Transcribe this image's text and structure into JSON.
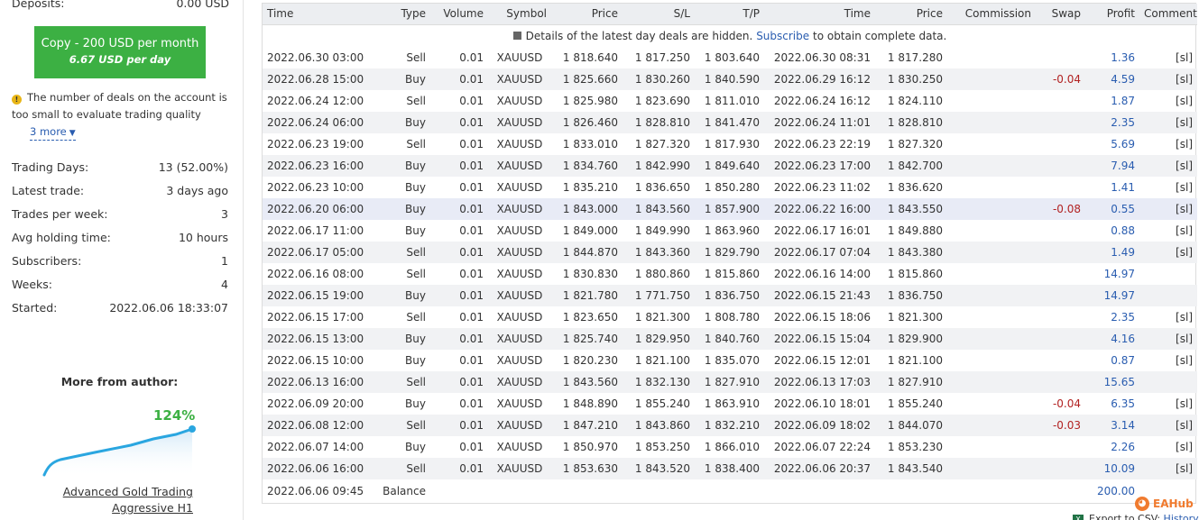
{
  "sidebar": {
    "deposits_label": "Deposits:",
    "deposits_value": "0.00 USD",
    "copy_button": {
      "line1": "Copy - 200 USD per month",
      "line2": "6.67 USD per day"
    },
    "warning": {
      "line1": "The number of deals on the account is",
      "line2": "too small to evaluate trading quality",
      "more": "3 more"
    },
    "stats": [
      {
        "label": "Trading Days:",
        "value": "13 (52.00%)"
      },
      {
        "label": "Latest trade:",
        "value": "3 days ago"
      },
      {
        "label": "Trades per week:",
        "value": "3"
      },
      {
        "label": "Avg holding time:",
        "value": "10 hours"
      },
      {
        "label": "Subscribers:",
        "value": "1"
      },
      {
        "label": "Weeks:",
        "value": "4"
      },
      {
        "label": "Started:",
        "value": "2022.06.06 18:33:07"
      }
    ],
    "more_from_author": "More from author:",
    "author_signal": {
      "growth": "124%",
      "name_line1": "Advanced Gold Trading",
      "name_line2": "Aggressive H1"
    }
  },
  "table": {
    "headers": [
      "Time",
      "Type",
      "Volume",
      "Symbol",
      "Price",
      "S/L",
      "T/P",
      "Time",
      "Price",
      "Commission",
      "Swap",
      "Profit",
      "Comment"
    ],
    "notice": {
      "before": "Details of the latest day deals are hidden.",
      "link": "Subscribe",
      "after": "to obtain complete data."
    },
    "rows": [
      [
        "2022.06.30 03:00",
        "Sell",
        "0.01",
        "XAUUSD",
        "1 818.640",
        "1 817.250",
        "1 803.640",
        "2022.06.30 08:31",
        "1 817.280",
        "",
        "",
        "1.36",
        "[sl]"
      ],
      [
        "2022.06.28 15:00",
        "Buy",
        "0.01",
        "XAUUSD",
        "1 825.660",
        "1 830.260",
        "1 840.590",
        "2022.06.29 16:12",
        "1 830.250",
        "",
        "-0.04",
        "4.59",
        "[sl]"
      ],
      [
        "2022.06.24 12:00",
        "Sell",
        "0.01",
        "XAUUSD",
        "1 825.980",
        "1 823.690",
        "1 811.010",
        "2022.06.24 16:12",
        "1 824.110",
        "",
        "",
        "1.87",
        "[sl]"
      ],
      [
        "2022.06.24 06:00",
        "Buy",
        "0.01",
        "XAUUSD",
        "1 826.460",
        "1 828.810",
        "1 841.470",
        "2022.06.24 11:01",
        "1 828.810",
        "",
        "",
        "2.35",
        "[sl]"
      ],
      [
        "2022.06.23 19:00",
        "Sell",
        "0.01",
        "XAUUSD",
        "1 833.010",
        "1 827.320",
        "1 817.930",
        "2022.06.23 22:19",
        "1 827.320",
        "",
        "",
        "5.69",
        "[sl]"
      ],
      [
        "2022.06.23 16:00",
        "Buy",
        "0.01",
        "XAUUSD",
        "1 834.760",
        "1 842.990",
        "1 849.640",
        "2022.06.23 17:00",
        "1 842.700",
        "",
        "",
        "7.94",
        "[sl]"
      ],
      [
        "2022.06.23 10:00",
        "Buy",
        "0.01",
        "XAUUSD",
        "1 835.210",
        "1 836.650",
        "1 850.280",
        "2022.06.23 11:02",
        "1 836.620",
        "",
        "",
        "1.41",
        "[sl]"
      ],
      [
        "2022.06.20 06:00",
        "Buy",
        "0.01",
        "XAUUSD",
        "1 843.000",
        "1 843.560",
        "1 857.900",
        "2022.06.22 16:00",
        "1 843.550",
        "",
        "-0.08",
        "0.55",
        "[sl]"
      ],
      [
        "2022.06.17 11:00",
        "Buy",
        "0.01",
        "XAUUSD",
        "1 849.000",
        "1 849.990",
        "1 863.960",
        "2022.06.17 16:01",
        "1 849.880",
        "",
        "",
        "0.88",
        "[sl]"
      ],
      [
        "2022.06.17 05:00",
        "Sell",
        "0.01",
        "XAUUSD",
        "1 844.870",
        "1 843.360",
        "1 829.790",
        "2022.06.17 07:04",
        "1 843.380",
        "",
        "",
        "1.49",
        "[sl]"
      ],
      [
        "2022.06.16 08:00",
        "Sell",
        "0.01",
        "XAUUSD",
        "1 830.830",
        "1 880.860",
        "1 815.860",
        "2022.06.16 14:00",
        "1 815.860",
        "",
        "",
        "14.97",
        ""
      ],
      [
        "2022.06.15 19:00",
        "Buy",
        "0.01",
        "XAUUSD",
        "1 821.780",
        "1 771.750",
        "1 836.750",
        "2022.06.15 21:43",
        "1 836.750",
        "",
        "",
        "14.97",
        ""
      ],
      [
        "2022.06.15 17:00",
        "Sell",
        "0.01",
        "XAUUSD",
        "1 823.650",
        "1 821.300",
        "1 808.780",
        "2022.06.15 18:06",
        "1 821.300",
        "",
        "",
        "2.35",
        "[sl]"
      ],
      [
        "2022.06.15 13:00",
        "Buy",
        "0.01",
        "XAUUSD",
        "1 825.740",
        "1 829.950",
        "1 840.760",
        "2022.06.15 15:04",
        "1 829.900",
        "",
        "",
        "4.16",
        "[sl]"
      ],
      [
        "2022.06.15 10:00",
        "Buy",
        "0.01",
        "XAUUSD",
        "1 820.230",
        "1 821.100",
        "1 835.070",
        "2022.06.15 12:01",
        "1 821.100",
        "",
        "",
        "0.87",
        "[sl]"
      ],
      [
        "2022.06.13 16:00",
        "Sell",
        "0.01",
        "XAUUSD",
        "1 843.560",
        "1 832.130",
        "1 827.910",
        "2022.06.13 17:03",
        "1 827.910",
        "",
        "",
        "15.65",
        ""
      ],
      [
        "2022.06.09 20:00",
        "Buy",
        "0.01",
        "XAUUSD",
        "1 848.890",
        "1 855.240",
        "1 863.910",
        "2022.06.10 18:01",
        "1 855.240",
        "",
        "-0.04",
        "6.35",
        "[sl]"
      ],
      [
        "2022.06.08 12:00",
        "Sell",
        "0.01",
        "XAUUSD",
        "1 847.210",
        "1 843.860",
        "1 832.210",
        "2022.06.09 18:02",
        "1 844.070",
        "",
        "-0.03",
        "3.14",
        "[sl]"
      ],
      [
        "2022.06.07 14:00",
        "Buy",
        "0.01",
        "XAUUSD",
        "1 850.970",
        "1 853.250",
        "1 866.010",
        "2022.06.07 22:24",
        "1 853.230",
        "",
        "",
        "2.26",
        "[sl]"
      ],
      [
        "2022.06.06 16:00",
        "Sell",
        "0.01",
        "XAUUSD",
        "1 853.630",
        "1 843.520",
        "1 838.400",
        "2022.06.06 20:37",
        "1 843.540",
        "",
        "",
        "10.09",
        "[sl]"
      ]
    ],
    "highlighted_row": 7,
    "balance_row": {
      "time": "2022.06.06 09:45",
      "type": "Balance",
      "profit": "200.00"
    }
  },
  "footer": {
    "watermark": "EAHub",
    "export_label": "Export to CSV:",
    "export_link": "History"
  },
  "colors": {
    "accent_green": "#3cb043",
    "link_blue": "#2a5db0",
    "negative_red": "#b22222"
  }
}
